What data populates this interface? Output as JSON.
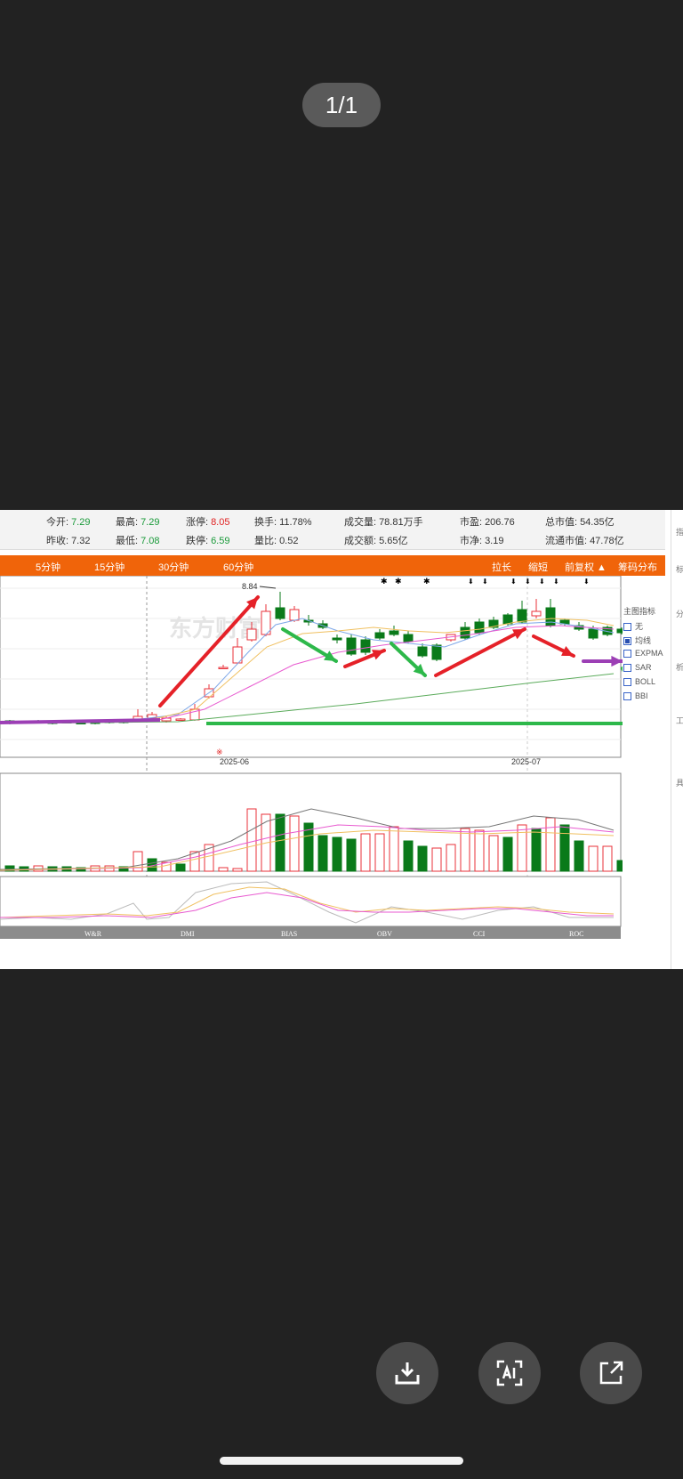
{
  "viewer": {
    "page_indicator": "1/1"
  },
  "quote": {
    "row1": [
      {
        "label": "今开:",
        "value": "7.29",
        "color": "green"
      },
      {
        "label": "最高:",
        "value": "7.29",
        "color": "green"
      },
      {
        "label": "涨停:",
        "value": "8.05",
        "color": "red"
      },
      {
        "label": "换手:",
        "value": "11.78%",
        "color": "dark"
      },
      {
        "label": "成交量:",
        "value": "78.81万手",
        "color": "dark"
      },
      {
        "label": "市盈:",
        "value": "206.76",
        "color": "dark"
      },
      {
        "label": "总市值:",
        "value": "54.35亿",
        "color": "dark"
      }
    ],
    "row2": [
      {
        "label": "昨收:",
        "value": "7.32",
        "color": "dark"
      },
      {
        "label": "最低:",
        "value": "7.08",
        "color": "green"
      },
      {
        "label": "跌停:",
        "value": "6.59",
        "color": "green"
      },
      {
        "label": "量比:",
        "value": "0.52",
        "color": "dark"
      },
      {
        "label": "成交额:",
        "value": "5.65亿",
        "color": "dark"
      },
      {
        "label": "市净:",
        "value": "3.19",
        "color": "dark"
      },
      {
        "label": "流通市值:",
        "value": "47.78亿",
        "color": "dark"
      }
    ]
  },
  "tabs": {
    "left": [
      "5分钟",
      "15分钟",
      "30分钟",
      "60分钟"
    ],
    "right": [
      "拉长",
      "缩短",
      "前复权 ▲",
      "筹码分布"
    ]
  },
  "chart": {
    "peak_label": "8.84",
    "x_labels": [
      "2025-06",
      "2025-07"
    ],
    "watermark": "东方财富",
    "legend_title": "主图指标",
    "legend_items": [
      {
        "label": "无",
        "checked": false
      },
      {
        "label": "均线",
        "checked": true
      },
      {
        "label": "EXPMA",
        "checked": false
      },
      {
        "label": "SAR",
        "checked": false
      },
      {
        "label": "BOLL",
        "checked": false
      },
      {
        "label": "BBI",
        "checked": false
      }
    ],
    "indicator_tabs": [
      "W&R",
      "DMI",
      "BIAS",
      "OBV",
      "CCI",
      "ROC"
    ],
    "marker": "※",
    "colors": {
      "up": "#e8303a",
      "down": "#0a7a1a",
      "ma5": "#7da7e8",
      "ma10": "#f0c060",
      "ma20": "#e85ad0",
      "ma60": "#5bab5b"
    }
  },
  "actions": [
    "download-button",
    "ai-text-button",
    "share-button"
  ]
}
